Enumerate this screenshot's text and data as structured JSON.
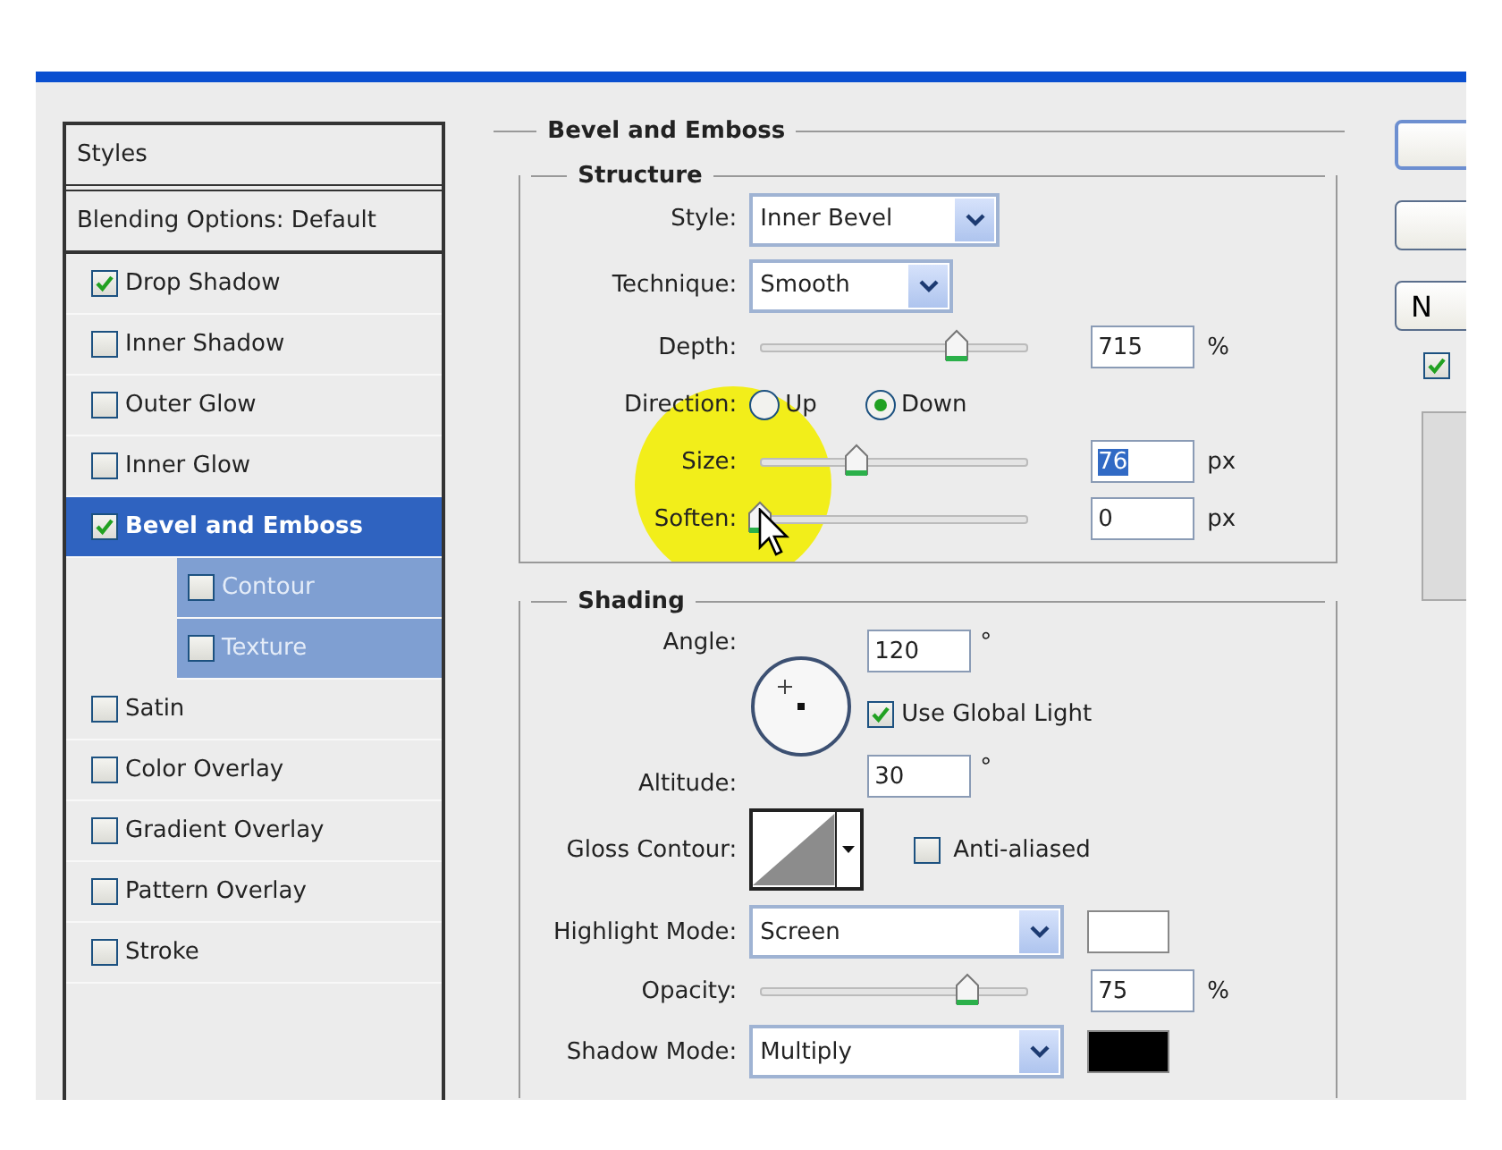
{
  "styles_panel": {
    "header": "Styles",
    "blending_options": "Blending Options: Default",
    "items": [
      {
        "label": "Drop Shadow",
        "checked": true,
        "selected": false
      },
      {
        "label": "Inner Shadow",
        "checked": false,
        "selected": false
      },
      {
        "label": "Outer Glow",
        "checked": false,
        "selected": false
      },
      {
        "label": "Inner Glow",
        "checked": false,
        "selected": false
      },
      {
        "label": "Bevel and Emboss",
        "checked": true,
        "selected": true,
        "children": [
          {
            "label": "Contour",
            "checked": false,
            "selected": false
          },
          {
            "label": "Texture",
            "checked": false,
            "selected": false
          }
        ]
      },
      {
        "label": "Satin",
        "checked": false,
        "selected": false
      },
      {
        "label": "Color Overlay",
        "checked": false,
        "selected": false
      },
      {
        "label": "Gradient Overlay",
        "checked": false,
        "selected": false
      },
      {
        "label": "Pattern Overlay",
        "checked": false,
        "selected": false
      },
      {
        "label": "Stroke",
        "checked": false,
        "selected": false
      }
    ]
  },
  "bevel_and_emboss": {
    "title": "Bevel and Emboss",
    "structure": {
      "title": "Structure",
      "rows": [
        {
          "kind": "select",
          "label": "Style:",
          "value": "Inner Bevel"
        },
        {
          "kind": "select",
          "label": "Technique:",
          "value": "Smooth"
        },
        {
          "kind": "slider",
          "label": "Depth:",
          "level": 0.73,
          "value": "715",
          "unit": "%",
          "text_selected": false
        },
        {
          "kind": "radio",
          "label": "Direction:",
          "options": [
            {
              "label": "Up",
              "selected": false
            },
            {
              "label": "Down",
              "selected": true
            }
          ]
        },
        {
          "kind": "slider",
          "label": "Size:",
          "level": 0.36,
          "value": "76",
          "unit": "px",
          "text_selected": true
        },
        {
          "kind": "slider",
          "label": "Soften:",
          "level": 0,
          "value": "0",
          "unit": "px",
          "text_selected": false
        }
      ]
    },
    "shading": {
      "title": "Shading",
      "angle": {
        "label": "Angle:",
        "value": "120",
        "unit": "°"
      },
      "global_light": {
        "label": "Use Global Light",
        "checked": true
      },
      "altitude": {
        "label": "Altitude:",
        "value": "30",
        "unit": "°"
      },
      "gloss_contour": {
        "label": "Gloss Contour:"
      },
      "anti_aliased": {
        "label": "Anti-aliased",
        "checked": false
      },
      "highlight_mode": {
        "label": "Highlight Mode:",
        "value": "Screen",
        "color": "#ffffff"
      },
      "opacity": {
        "label": "Opacity:",
        "level": 0.77,
        "value": "75",
        "unit": "%",
        "text_selected": false
      },
      "shadow_mode": {
        "label": "Shadow Mode:",
        "value": "Multiply",
        "color": "#000000"
      }
    }
  },
  "side_buttons": [
    {
      "default": true
    },
    {
      "default": false
    },
    {
      "default": false,
      "label": "N"
    }
  ],
  "preview_checkbox": {
    "checked": true
  }
}
